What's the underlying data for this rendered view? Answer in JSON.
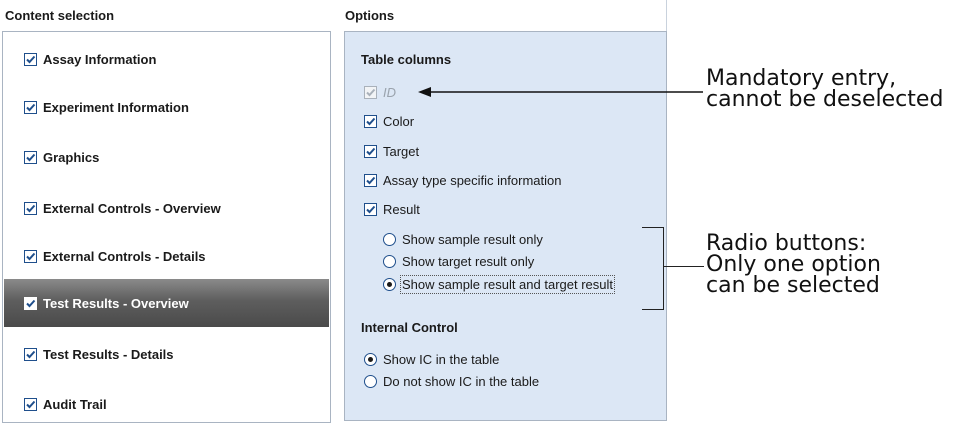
{
  "content_selection": {
    "header": "Content selection",
    "items": [
      {
        "label": "Assay Information",
        "checked": true,
        "selected": false
      },
      {
        "label": "Experiment Information",
        "checked": true,
        "selected": false
      },
      {
        "label": "Graphics",
        "checked": true,
        "selected": false
      },
      {
        "label": "External Controls - Overview",
        "checked": true,
        "selected": false
      },
      {
        "label": "External Controls - Details",
        "checked": true,
        "selected": false
      },
      {
        "label": "Test Results - Overview",
        "checked": true,
        "selected": true
      },
      {
        "label": "Test Results - Details",
        "checked": true,
        "selected": false
      },
      {
        "label": "Audit Trail",
        "checked": true,
        "selected": false
      }
    ]
  },
  "options": {
    "header": "Options",
    "table_columns": {
      "title": "Table columns",
      "id_label": "ID",
      "color_label": "Color",
      "target_label": "Target",
      "assay_type_label": "Assay type specific information",
      "result_label": "Result",
      "result_radios": [
        {
          "label": "Show sample result only",
          "selected": false
        },
        {
          "label": "Show target result only",
          "selected": false
        },
        {
          "label": "Show sample result and target result",
          "selected": true
        }
      ]
    },
    "internal_control": {
      "title": "Internal Control",
      "radios": [
        {
          "label": "Show IC in the table",
          "selected": true
        },
        {
          "label": "Do not show IC in the table",
          "selected": false
        }
      ]
    }
  },
  "annotations": {
    "mandatory": "Mandatory entry,\ncannot be deselected",
    "radio": "Radio buttons:\nOnly one option\ncan be selected"
  },
  "colors": {
    "options_bg": "#dce7f5",
    "selected_item_bg": "#5e5e5e",
    "checkbox_border": "#1f4f8c"
  }
}
